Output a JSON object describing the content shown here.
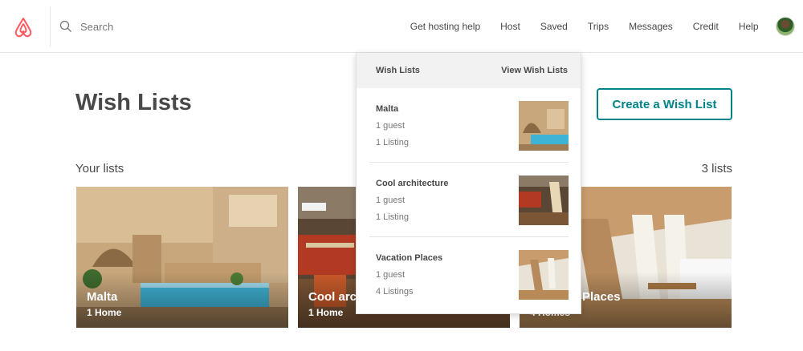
{
  "header": {
    "search_placeholder": "Search",
    "nav": [
      "Get hosting help",
      "Host",
      "Saved",
      "Trips",
      "Messages",
      "Credit",
      "Help"
    ]
  },
  "page": {
    "title": "Wish Lists",
    "create_button": "Create a Wish List",
    "your_lists": "Your lists",
    "list_count": "3 lists"
  },
  "cards": [
    {
      "title": "Malta",
      "subtitle": "1 Home"
    },
    {
      "title": "Cool arc",
      "subtitle": "1 Home"
    },
    {
      "title": "Places",
      "subtitle": "4 Homes"
    }
  ],
  "dropdown": {
    "header_label": "Wish Lists",
    "view_link": "View Wish Lists",
    "items": [
      {
        "name": "Malta",
        "guests": "1 guest",
        "listings": "1 Listing"
      },
      {
        "name": "Cool architecture",
        "guests": "1 guest",
        "listings": "1 Listing"
      },
      {
        "name": "Vacation Places",
        "guests": "1 guest",
        "listings": "4 Listings"
      }
    ]
  },
  "colors": {
    "brand": "#ff5a5f",
    "accent": "#00848a",
    "text": "#484848",
    "muted": "#767676"
  },
  "icons": {
    "logo": "airbnb-logo",
    "search": "search-icon",
    "avatar": "user-avatar"
  }
}
